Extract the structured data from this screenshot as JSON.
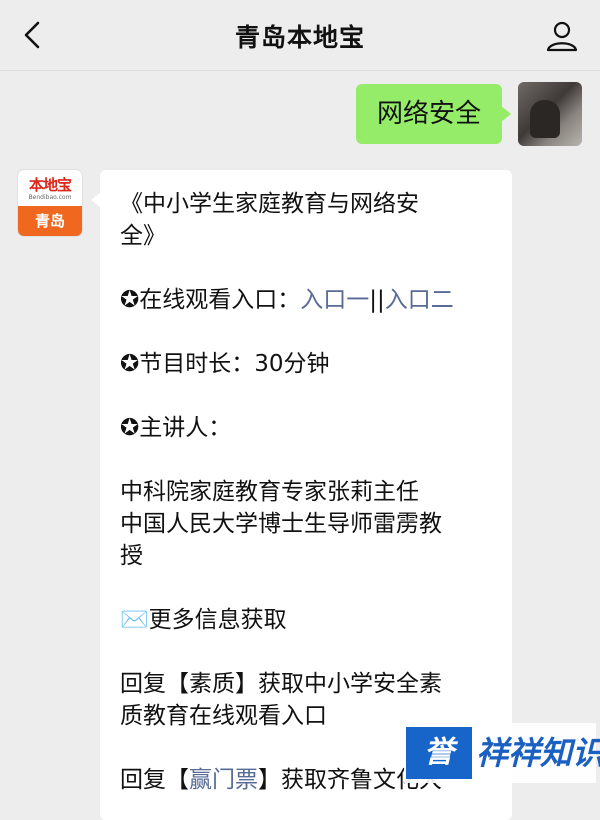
{
  "header": {
    "title": "青岛本地宝",
    "back_icon": "chevron-left-icon",
    "profile_icon": "person-icon"
  },
  "sent_message": {
    "text": "网络安全"
  },
  "brand_avatar": {
    "top_text": "本地宝",
    "sub_text": "Bendibao.com",
    "band_text": "青岛"
  },
  "reply": {
    "title_line1": "《中小学生家庭教育与网络安",
    "title_line2": "全》",
    "watch_prefix": "✪在线观看入口：",
    "entry1": "入口一",
    "separator": "||",
    "entry2": "入口二",
    "duration": "✪节目时长：30分钟",
    "speakers_label": "✪主讲人：",
    "speaker1": "中科院家庭教育专家张莉主任",
    "speaker2_line1": "中国人民大学博士生导师雷雳教",
    "speaker2_line2": "授",
    "more_info": "✉️更多信息获取",
    "reply1_line1": "回复【素质】获取中小学安全素",
    "reply1_line2": "质教育在线观看入口",
    "reply2_prefix": "回复【",
    "reply2_link": "赢门票",
    "reply2_suffix": "】获取齐鲁文化大"
  },
  "watermark": {
    "box_text": "誉",
    "text": "祥祥知识"
  },
  "colors": {
    "link": "#576b95",
    "bubble_green": "#95ec69",
    "brand_orange": "#f0671f"
  }
}
